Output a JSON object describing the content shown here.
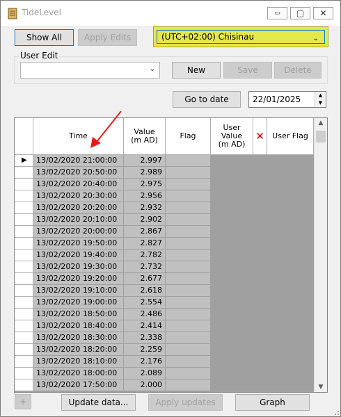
{
  "window": {
    "title": "TideLevel",
    "controls": {
      "minimize": "▭",
      "maximize": "▢",
      "close": "✕"
    }
  },
  "toolbar": {
    "show_all": "Show All",
    "apply_edits": "Apply Edits",
    "timezone": "(UTC+02:00) Chisinau"
  },
  "user_edit": {
    "label": "User Edit",
    "selected": "",
    "new": "New",
    "save": "Save",
    "delete": "Delete"
  },
  "goto": {
    "button": "Go to date",
    "date": "22/01/2025"
  },
  "grid": {
    "headers": {
      "time": "Time",
      "value_line1": "Value",
      "value_line2": "(m AD)",
      "flag": "Flag",
      "user_value_line1": "User",
      "user_value_line2": "Value",
      "user_value_line3": "(m AD)",
      "delete_icon": "✕",
      "user_flag": "User Flag"
    },
    "rows": [
      {
        "time": "13/02/2020 21:00:00",
        "value": "2.997",
        "flag": ""
      },
      {
        "time": "13/02/2020 20:50:00",
        "value": "2.989",
        "flag": ""
      },
      {
        "time": "13/02/2020 20:40:00",
        "value": "2.975",
        "flag": ""
      },
      {
        "time": "13/02/2020 20:30:00",
        "value": "2.956",
        "flag": ""
      },
      {
        "time": "13/02/2020 20:20:00",
        "value": "2.932",
        "flag": ""
      },
      {
        "time": "13/02/2020 20:10:00",
        "value": "2.902",
        "flag": ""
      },
      {
        "time": "13/02/2020 20:00:00",
        "value": "2.867",
        "flag": ""
      },
      {
        "time": "13/02/2020 19:50:00",
        "value": "2.827",
        "flag": ""
      },
      {
        "time": "13/02/2020 19:40:00",
        "value": "2.782",
        "flag": ""
      },
      {
        "time": "13/02/2020 19:30:00",
        "value": "2.732",
        "flag": ""
      },
      {
        "time": "13/02/2020 19:20:00",
        "value": "2.677",
        "flag": ""
      },
      {
        "time": "13/02/2020 19:10:00",
        "value": "2.618",
        "flag": ""
      },
      {
        "time": "13/02/2020 19:00:00",
        "value": "2.554",
        "flag": ""
      },
      {
        "time": "13/02/2020 18:50:00",
        "value": "2.486",
        "flag": ""
      },
      {
        "time": "13/02/2020 18:40:00",
        "value": "2.414",
        "flag": ""
      },
      {
        "time": "13/02/2020 18:30:00",
        "value": "2.338",
        "flag": ""
      },
      {
        "time": "13/02/2020 18:20:00",
        "value": "2.259",
        "flag": ""
      },
      {
        "time": "13/02/2020 18:10:00",
        "value": "2.176",
        "flag": ""
      },
      {
        "time": "13/02/2020 18:00:00",
        "value": "2.089",
        "flag": ""
      },
      {
        "time": "13/02/2020 17:50:00",
        "value": "2.000",
        "flag": ""
      }
    ],
    "current_row_marker": "▶"
  },
  "bottom": {
    "add": "+",
    "update_data": "Update data...",
    "apply_updates": "Apply updates",
    "graph": "Graph"
  },
  "colors": {
    "timezone_highlight": "#e5e84a",
    "annotation_arrow": "#e8191b",
    "delete_icon": "#c00000",
    "focus_border": "#0078d7"
  }
}
